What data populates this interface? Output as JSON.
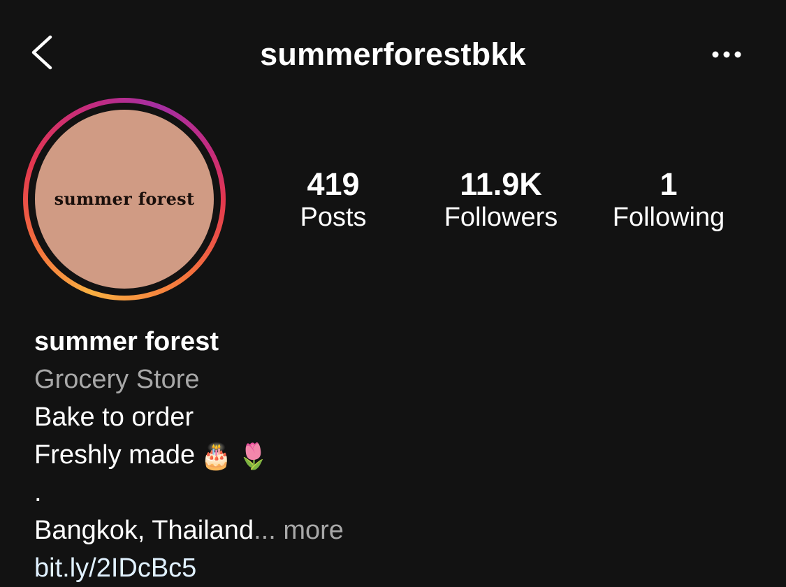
{
  "header": {
    "back_icon": "chevron-left-icon",
    "username": "summerforestbkk",
    "more_icon": "more-horizontal-icon"
  },
  "profile": {
    "avatar_text": "summer forest",
    "story_ring_colors": [
      "#f9b042",
      "#f5733d",
      "#e3374f",
      "#c42c7f",
      "#a52fa3"
    ],
    "avatar_bg": "#d09b84"
  },
  "stats": [
    {
      "value": "419",
      "label": "Posts"
    },
    {
      "value": "11.9K",
      "label": "Followers"
    },
    {
      "value": "1",
      "label": "Following"
    }
  ],
  "bio": {
    "display_name": "summer forest",
    "category": "Grocery Store",
    "lines": [
      "Bake to order",
      "Freshly made",
      ".",
      "Bangkok, Thailand"
    ],
    "emojis": [
      "🎂",
      "🌷"
    ],
    "ellipsis": "...",
    "more_label": "more",
    "website": "bit.ly/2IDcBc5"
  },
  "colors": {
    "background": "#121212",
    "text": "#ffffff",
    "secondary_text": "#a8a8a8",
    "link": "#e0f1ff"
  }
}
